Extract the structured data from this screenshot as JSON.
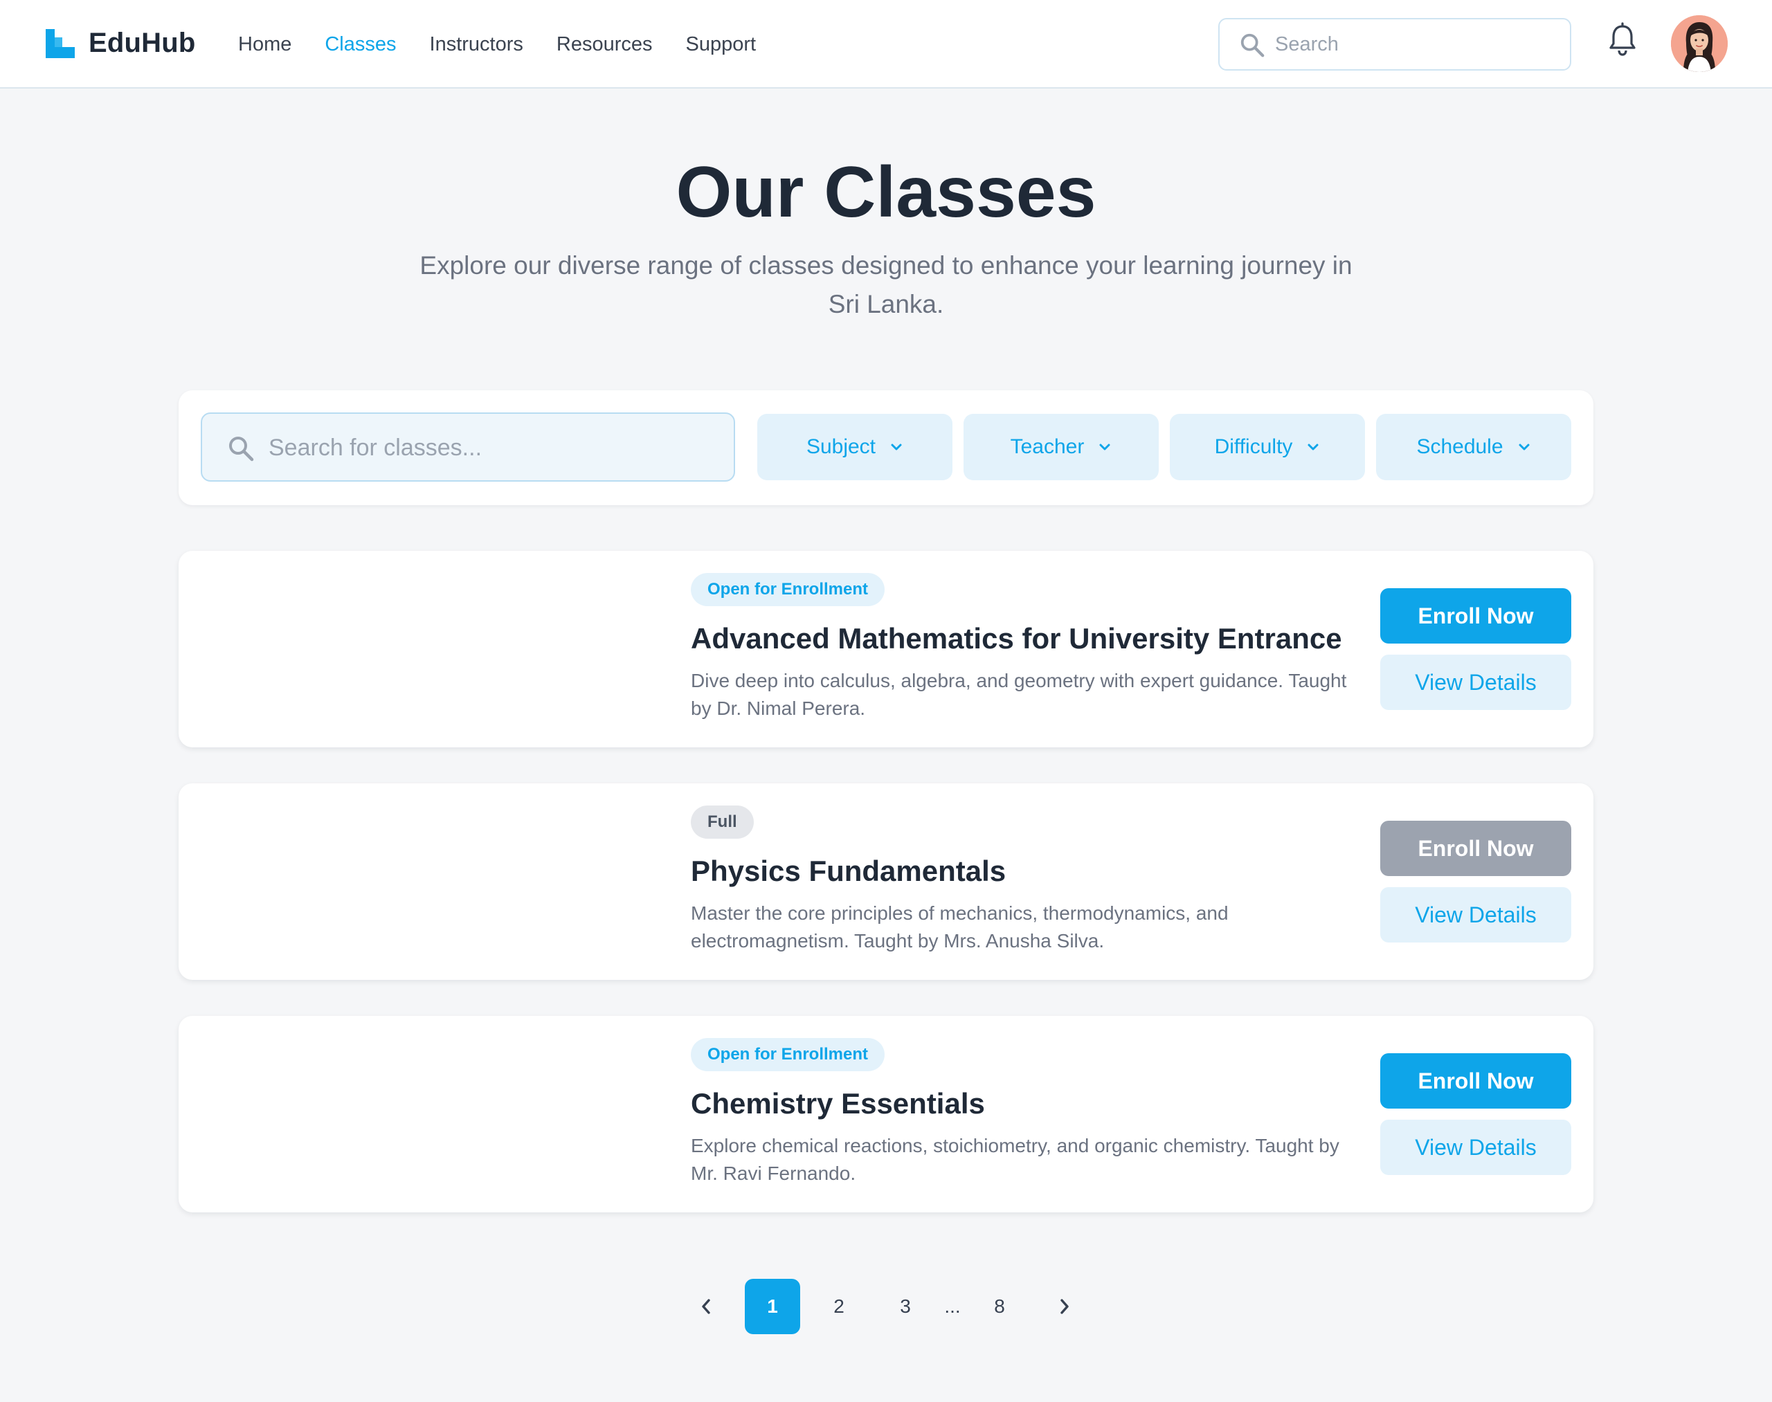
{
  "brand": {
    "name": "EduHub",
    "color": "#0ea5e9"
  },
  "nav": {
    "items": [
      {
        "label": "Home",
        "active": false
      },
      {
        "label": "Classes",
        "active": true
      },
      {
        "label": "Instructors",
        "active": false
      },
      {
        "label": "Resources",
        "active": false
      },
      {
        "label": "Support",
        "active": false
      }
    ]
  },
  "header_search": {
    "placeholder": "Search",
    "icon": "search-icon"
  },
  "header_icons": {
    "notifications": "bell-icon",
    "profile": "user-avatar"
  },
  "hero": {
    "title": "Our Classes",
    "subtitle": "Explore our diverse range of classes designed to enhance your learning journey in Sri Lanka."
  },
  "filters": {
    "search_placeholder": "Search for classes...",
    "dropdowns": [
      {
        "label": "Subject",
        "icon": "chevron-down-icon"
      },
      {
        "label": "Teacher",
        "icon": "chevron-down-icon"
      },
      {
        "label": "Difficulty",
        "icon": "chevron-down-icon"
      },
      {
        "label": "Schedule",
        "icon": "chevron-down-icon"
      }
    ]
  },
  "classes": [
    {
      "status": "Open for Enrollment",
      "status_type": "open",
      "title": "Advanced Mathematics for University Entrance",
      "description": "Dive deep into calculus, algebra, and geometry with expert guidance. Taught by Dr. Nimal Perera.",
      "enroll_label": "Enroll Now",
      "enroll_enabled": true,
      "details_label": "View Details"
    },
    {
      "status": "Full",
      "status_type": "full",
      "title": "Physics Fundamentals",
      "description": "Master the core principles of mechanics, thermodynamics, and electromagnetism. Taught by Mrs. Anusha Silva.",
      "enroll_label": "Enroll Now",
      "enroll_enabled": false,
      "details_label": "View Details"
    },
    {
      "status": "Open for Enrollment",
      "status_type": "open",
      "title": "Chemistry Essentials",
      "description": "Explore chemical reactions, stoichiometry, and organic chemistry. Taught by Mr. Ravi Fernando.",
      "enroll_label": "Enroll Now",
      "enroll_enabled": true,
      "details_label": "View Details"
    }
  ],
  "pagination": {
    "current": "1",
    "pages": [
      "1",
      "2",
      "3",
      "8"
    ],
    "ellipsis": "...",
    "prev_icon": "chevron-left-icon",
    "next_icon": "chevron-right-icon"
  },
  "colors": {
    "accent": "#0ea5e9",
    "accent_light": "#e3f2fb",
    "disabled": "#9ca3af",
    "background": "#f5f6f8"
  }
}
